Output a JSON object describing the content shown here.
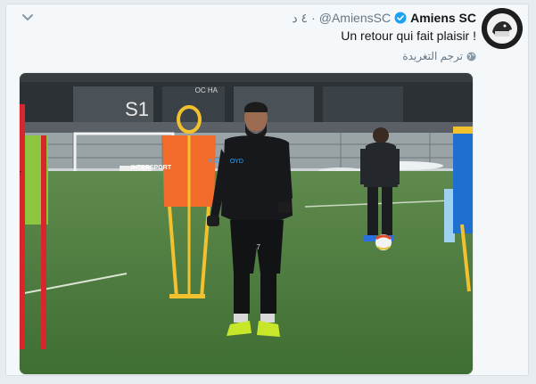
{
  "tweet": {
    "display_name": "Amiens SC",
    "handle": "@AmiensSC",
    "dot": "·",
    "time": "٤ د",
    "text": "Un retour qui fait plaisir !",
    "translate_label": "ترجم التغريدة"
  },
  "photo": {
    "building_sign_1": "S1",
    "building_sign_2": "ОС НА",
    "bib_brand": "INTERSPORT",
    "jersey_sponsor": "MAC LLOYD",
    "shorts_number": "7"
  },
  "icons": {
    "menu": "chevron-down-icon",
    "verified": "verified-badge-icon",
    "translate": "globe-icon"
  },
  "colors": {
    "verified_blue": "#1da1f2",
    "text": "#14171a",
    "muted": "#657786"
  }
}
